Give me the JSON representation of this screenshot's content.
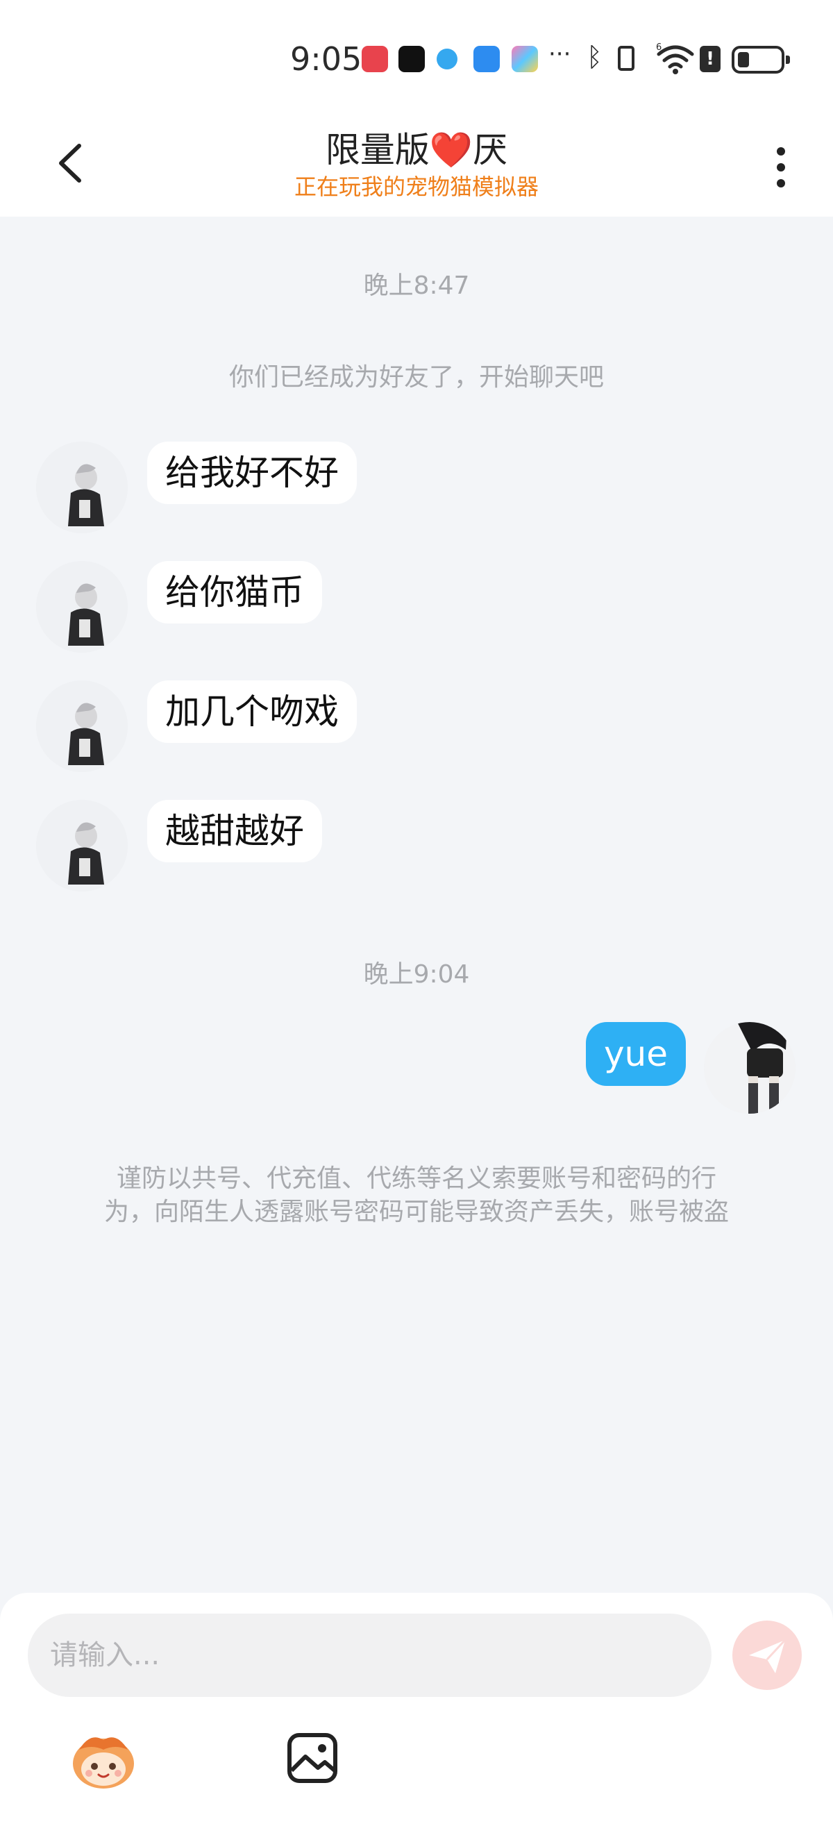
{
  "status_bar": {
    "time": "9:05",
    "signal_label": "6",
    "alert_glyph": "!"
  },
  "header": {
    "title_before": "限量版",
    "title_heart": "❤️",
    "title_after": "厌",
    "subtitle": "正在玩我的宠物猫模拟器"
  },
  "chat": {
    "timestamp_1": "晚上8:47",
    "system_message": "你们已经成为好友了，开始聊天吧",
    "incoming_messages": [
      "给我好不好",
      "给你猫币",
      "加几个吻戏",
      "越甜越好"
    ],
    "timestamp_2": "晚上9:04",
    "outgoing_messages": [
      "yue"
    ],
    "warning_line_1": "谨防以共号、代充值、代练等名义索要账号和密码的行",
    "warning_line_2": "为，向陌生人透露账号密码可能导致资产丢失，账号被盗"
  },
  "input": {
    "placeholder": "请输入..."
  },
  "icons": {
    "back": "back-arrow-icon",
    "more": "more-vertical-icon",
    "send": "send-paper-plane-icon",
    "emoji": "mascot-emoji-icon",
    "image": "image-gallery-icon"
  },
  "colors": {
    "accent_orange": "#ef7f1a",
    "outgoing_bubble": "#2eb0f4",
    "send_button": "#fbd9d7",
    "chat_background": "#f3f5f8"
  }
}
